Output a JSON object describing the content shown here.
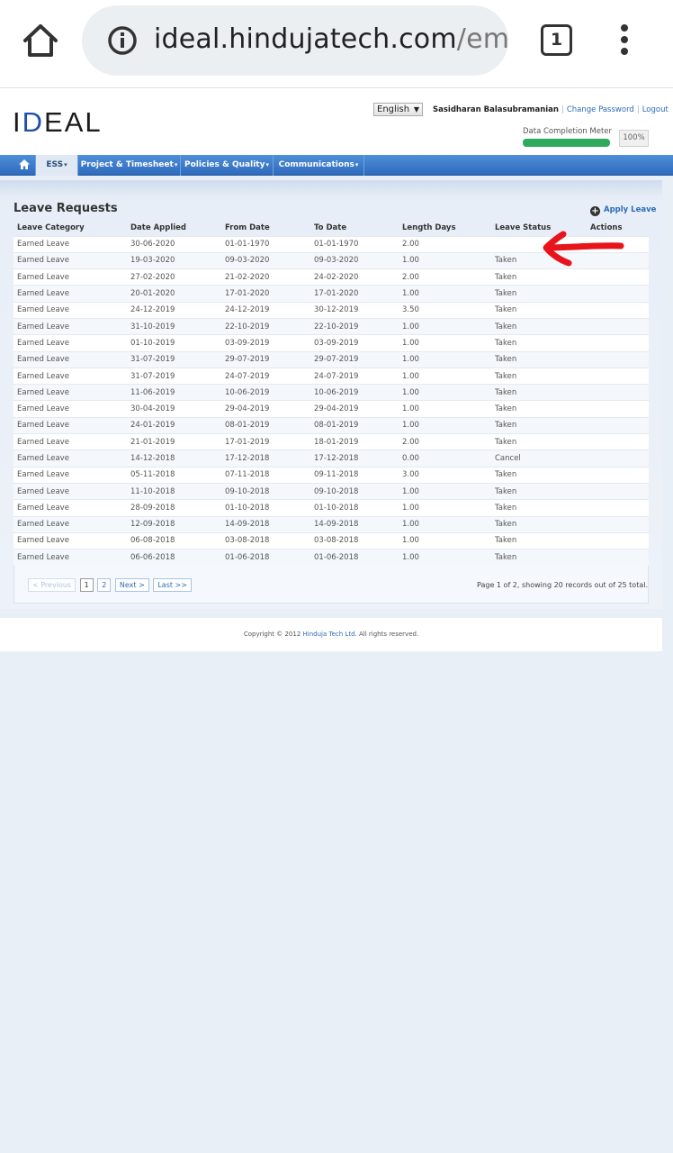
{
  "browser": {
    "url_host": "ideal.hindujatech.com",
    "url_path": "/empl",
    "tab_count": "1"
  },
  "header": {
    "logo": "IDEAL",
    "language": "English",
    "user_name": "Sasidharan Balasubramanian",
    "change_password": "Change Password",
    "logout": "Logout",
    "meter_label": "Data Completion Meter",
    "meter_value": "100%",
    "meter_fraction": 1.0
  },
  "nav": {
    "items": [
      {
        "label": "ESS"
      },
      {
        "label": "Project & Timesheet"
      },
      {
        "label": "Policies & Quality"
      },
      {
        "label": "Communications"
      }
    ]
  },
  "page": {
    "title": "Leave Requests",
    "apply_leave": "Apply Leave"
  },
  "table": {
    "headers": [
      "Leave Category",
      "Date Applied",
      "From Date",
      "To Date",
      "Length Days",
      "Leave Status",
      "Actions"
    ],
    "rows": [
      [
        "Earned Leave",
        "30-06-2020",
        "01-01-1970",
        "01-01-1970",
        "2.00",
        "",
        ""
      ],
      [
        "Earned Leave",
        "19-03-2020",
        "09-03-2020",
        "09-03-2020",
        "1.00",
        "Taken",
        ""
      ],
      [
        "Earned Leave",
        "27-02-2020",
        "21-02-2020",
        "24-02-2020",
        "2.00",
        "Taken",
        ""
      ],
      [
        "Earned Leave",
        "20-01-2020",
        "17-01-2020",
        "17-01-2020",
        "1.00",
        "Taken",
        ""
      ],
      [
        "Earned Leave",
        "24-12-2019",
        "24-12-2019",
        "30-12-2019",
        "3.50",
        "Taken",
        ""
      ],
      [
        "Earned Leave",
        "31-10-2019",
        "22-10-2019",
        "22-10-2019",
        "1.00",
        "Taken",
        ""
      ],
      [
        "Earned Leave",
        "01-10-2019",
        "03-09-2019",
        "03-09-2019",
        "1.00",
        "Taken",
        ""
      ],
      [
        "Earned Leave",
        "31-07-2019",
        "29-07-2019",
        "29-07-2019",
        "1.00",
        "Taken",
        ""
      ],
      [
        "Earned Leave",
        "31-07-2019",
        "24-07-2019",
        "24-07-2019",
        "1.00",
        "Taken",
        ""
      ],
      [
        "Earned Leave",
        "11-06-2019",
        "10-06-2019",
        "10-06-2019",
        "1.00",
        "Taken",
        ""
      ],
      [
        "Earned Leave",
        "30-04-2019",
        "29-04-2019",
        "29-04-2019",
        "1.00",
        "Taken",
        ""
      ],
      [
        "Earned Leave",
        "24-01-2019",
        "08-01-2019",
        "08-01-2019",
        "1.00",
        "Taken",
        ""
      ],
      [
        "Earned Leave",
        "21-01-2019",
        "17-01-2019",
        "18-01-2019",
        "2.00",
        "Taken",
        ""
      ],
      [
        "Earned Leave",
        "14-12-2018",
        "17-12-2018",
        "17-12-2018",
        "0.00",
        "Cancel",
        ""
      ],
      [
        "Earned Leave",
        "05-11-2018",
        "07-11-2018",
        "09-11-2018",
        "3.00",
        "Taken",
        ""
      ],
      [
        "Earned Leave",
        "11-10-2018",
        "09-10-2018",
        "09-10-2018",
        "1.00",
        "Taken",
        ""
      ],
      [
        "Earned Leave",
        "28-09-2018",
        "01-10-2018",
        "01-10-2018",
        "1.00",
        "Taken",
        ""
      ],
      [
        "Earned Leave",
        "12-09-2018",
        "14-09-2018",
        "14-09-2018",
        "1.00",
        "Taken",
        ""
      ],
      [
        "Earned Leave",
        "06-08-2018",
        "03-08-2018",
        "03-08-2018",
        "1.00",
        "Taken",
        ""
      ],
      [
        "Earned Leave",
        "06-06-2018",
        "01-06-2018",
        "01-06-2018",
        "1.00",
        "Taken",
        ""
      ]
    ]
  },
  "pager": {
    "previous": "< Previous",
    "pages": [
      "1",
      "2"
    ],
    "next": "Next >",
    "last": "Last >>",
    "summary": "Page 1 of 2, showing 20 records out of 25 total."
  },
  "footer": {
    "prefix": "Copyright © 2012",
    "company": "Hinduja Tech Ltd.",
    "suffix": "All rights reserved."
  },
  "colors": {
    "nav": "#2e6bbd",
    "meter": "#2eaa5c",
    "link": "#2b6cb5",
    "annotation": "#e8141c"
  }
}
